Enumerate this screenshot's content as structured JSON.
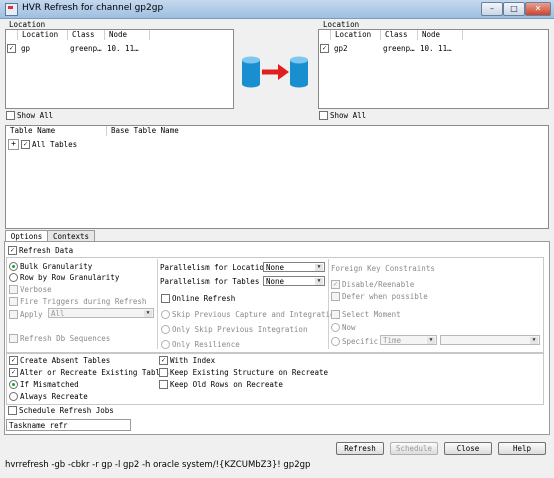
{
  "window": {
    "title": "HVR Refresh for channel gp2gp"
  },
  "left_panel": {
    "group_label": "Location",
    "columns": [
      "Location",
      "Class",
      "Node"
    ],
    "rows": [
      {
        "checked": true,
        "location": "gp",
        "class": "greenp…",
        "node": "10. 11…"
      }
    ],
    "show_all": "Show All"
  },
  "right_panel": {
    "group_label": "Location",
    "columns": [
      "Location",
      "Class",
      "Node"
    ],
    "rows": [
      {
        "checked": true,
        "location": "gp2",
        "class": "greenp…",
        "node": "10. 11…"
      }
    ],
    "show_all": "Show All"
  },
  "tables": {
    "columns": [
      "Table Name",
      "Base Table Name"
    ],
    "tree_item": "All Tables",
    "tree_toggle": "+"
  },
  "tabs": [
    "Options",
    "Contexts"
  ],
  "options": {
    "refresh_data": "Refresh Data",
    "bulk": "Bulk Granularity",
    "row_by_row": "Row by Row Granularity",
    "verbose": "Verbose",
    "fire_triggers": "Fire Triggers during Refresh",
    "apply": "Apply",
    "apply_value": "All",
    "refresh_db_sequences": "Refresh Db Sequences",
    "par_locations_label": "Parallelism for Locations",
    "par_locations_value": "None",
    "par_tables_label": "Parallelism for Tables",
    "par_tables_value": "None",
    "online_refresh": "Online Refresh",
    "skip_prev": "Skip Previous Capture and Integration",
    "only_skip_prev": "Only Skip Previous Integration",
    "only_resilience": "Only Resilience",
    "fk_constraints": "Foreign Key Constraints",
    "disable_reenable": "Disable/Reenable",
    "defer": "Defer when possible",
    "select_moment": "Select Moment",
    "now": "Now",
    "specific": "Specific",
    "specific_value": "Time",
    "create_absent": "Create Absent Tables",
    "alter_recreate": "Alter or Recreate Existing Tables",
    "if_mismatched": "If Mismatched",
    "always_recreate": "Always Recreate",
    "with_index": "With Index",
    "keep_existing": "Keep Existing Structure on Recreate",
    "keep_old_rows": "Keep Old Rows on Recreate",
    "schedule": "Schedule Refresh Jobs",
    "taskname": "Taskname refr"
  },
  "buttons": {
    "refresh": "Refresh",
    "schedule": "Schedule",
    "close": "Close",
    "help": "Help"
  },
  "status_command": "hvrrefresh -gb -cbkr -r gp -l gp2 -h oracle system/!{KZCUMbZ3}! gp2gp",
  "colors": {
    "arrow": "#e02020",
    "cylinder": "#1a8fd0",
    "checkmark": "#1a3a6a"
  }
}
